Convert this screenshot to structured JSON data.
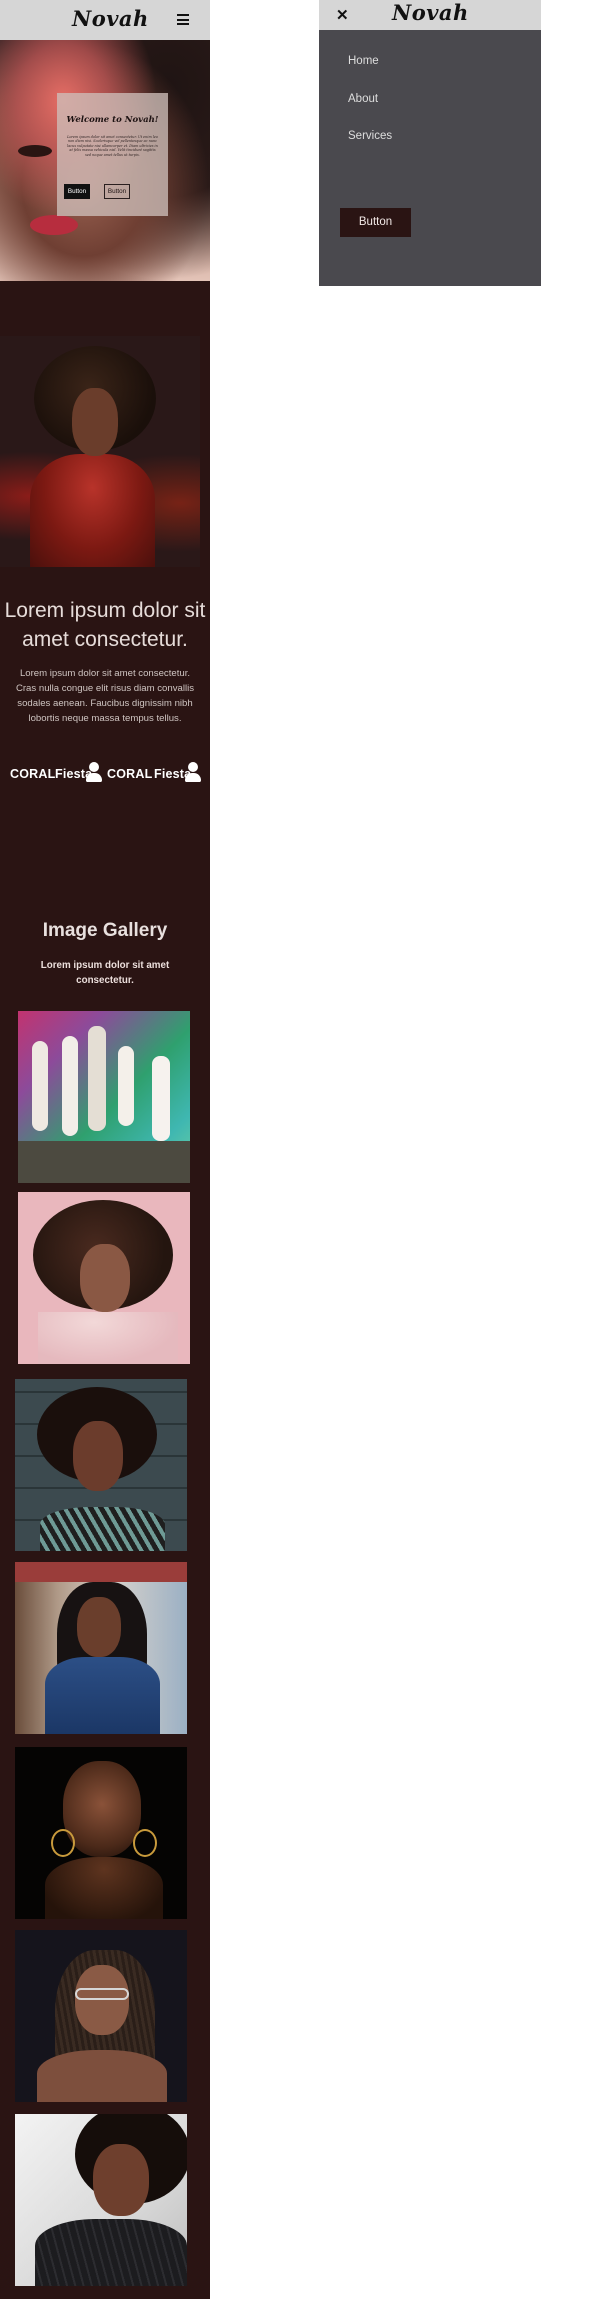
{
  "brand": {
    "logo_text": "Novah"
  },
  "hero": {
    "title": "Welcome to Novah!",
    "body": "Lorem ipsum dolor sit amet consectetur. Ut enim leo non diam nisi. Scelerisque vel pellentesque ac nunc lacus vulputate nisi ullamcorper et. Diam ultricies in at felis massa vehicula nisl. Velit tincidunt sagittis sed neque amet tellus ut turpis.",
    "primary_button": "Button",
    "secondary_button": "Button"
  },
  "intro": {
    "headline": "Lorem ipsum dolor sit amet consectetur.",
    "text": "Lorem ipsum dolor sit amet consectetur. Cras nulla congue elit risus diam convallis sodales aenean. Faucibus dignissim nibh lobortis neque massa tempus tellus."
  },
  "brand_strip": {
    "items": [
      "CORAL",
      "Fiesta",
      "CORAL",
      "Fiesta"
    ]
  },
  "gallery": {
    "title": "Image Gallery",
    "subtitle": "Lorem ipsum dolor sit amet consectetur."
  },
  "menu": {
    "close_icon": "close-icon",
    "items": [
      {
        "label": "Home"
      },
      {
        "label": "About"
      },
      {
        "label": "Services"
      }
    ],
    "button_label": "Button"
  },
  "icons": {
    "menu": "hamburger-icon",
    "brand_person": "person-icon"
  },
  "colors": {
    "page_bg": "#2a1413",
    "header_bg": "#d6d6d6",
    "menu_bg": "#4a494e",
    "accent_button": "#2a1413"
  }
}
